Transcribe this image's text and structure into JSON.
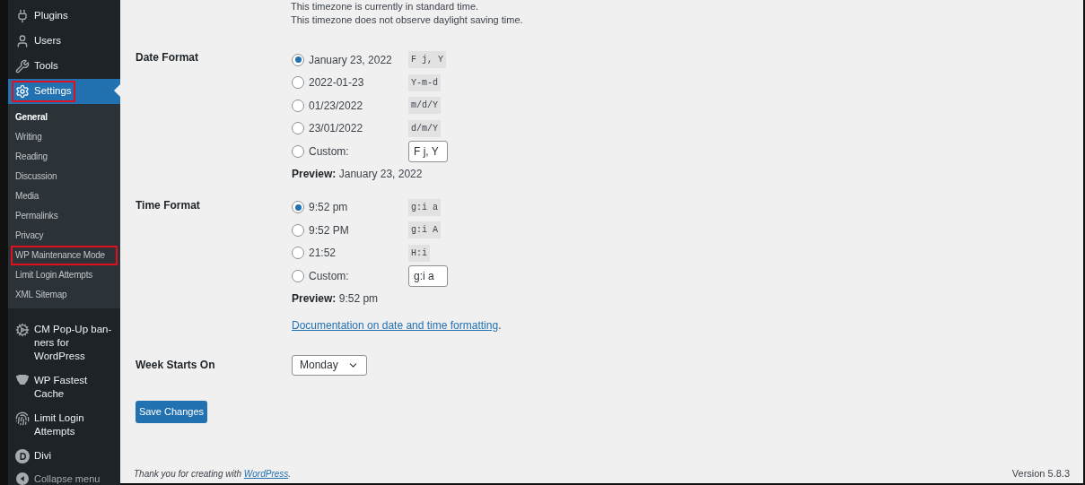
{
  "sidebar": {
    "items": [
      {
        "label": "Plugins",
        "selected": false,
        "highlighted": false
      },
      {
        "label": "Users",
        "selected": false,
        "highlighted": false
      },
      {
        "label": "Tools",
        "selected": false,
        "highlighted": false
      },
      {
        "label": "Settings",
        "selected": true,
        "highlighted": true,
        "submenu": [
          {
            "label": "General",
            "selected": true,
            "highlighted": false
          },
          {
            "label": "Writing",
            "selected": false,
            "highlighted": false
          },
          {
            "label": "Reading",
            "selected": false,
            "highlighted": false
          },
          {
            "label": "Discussion",
            "selected": false,
            "highlighted": false
          },
          {
            "label": "Media",
            "selected": false,
            "highlighted": false
          },
          {
            "label": "Permalinks",
            "selected": false,
            "highlighted": false
          },
          {
            "label": "Privacy",
            "selected": false,
            "highlighted": false
          },
          {
            "label": "WP Maintenance Mode",
            "selected": false,
            "highlighted": true
          },
          {
            "label": "Limit Login Attempts",
            "selected": false,
            "highlighted": false
          },
          {
            "label": "XML Sitemap",
            "selected": false,
            "highlighted": false
          }
        ]
      },
      {
        "label": "CM Pop-Up ban-ners for WordPress",
        "selected": false,
        "highlighted": false
      },
      {
        "label": "WP Fastest Cache",
        "selected": false,
        "highlighted": false
      },
      {
        "label": "Limit Login Attempts",
        "selected": false,
        "highlighted": false
      },
      {
        "label": "Divi",
        "selected": false,
        "highlighted": false
      }
    ],
    "collapse": "Collapse menu"
  },
  "timezone_notes": [
    "This timezone is currently in standard time.",
    "This timezone does not observe daylight saving time."
  ],
  "sections": [
    {
      "label": "Date Format",
      "options": [
        {
          "kind": "preset",
          "label": "January 23, 2022",
          "code": "F j, Y",
          "selected": true
        },
        {
          "kind": "preset",
          "label": "2022-01-23",
          "code": "Y-m-d",
          "selected": false
        },
        {
          "kind": "preset",
          "label": "01/23/2022",
          "code": "m/d/Y",
          "selected": false
        },
        {
          "kind": "preset",
          "label": "23/01/2022",
          "code": "d/m/Y",
          "selected": false
        },
        {
          "kind": "custom",
          "label": "Custom:",
          "value": "F j, Y",
          "selected": false
        }
      ],
      "preview_label": "Preview:",
      "preview": "January 23, 2022"
    },
    {
      "label": "Time Format",
      "options": [
        {
          "kind": "preset",
          "label": "9:52 pm",
          "code": "g:i a",
          "selected": true
        },
        {
          "kind": "preset",
          "label": "9:52 PM",
          "code": "g:i A",
          "selected": false
        },
        {
          "kind": "preset",
          "label": "21:52",
          "code": "H:i",
          "selected": false
        },
        {
          "kind": "custom",
          "label": "Custom:",
          "value": "g:i a",
          "selected": false
        }
      ],
      "preview_label": "Preview:",
      "preview": "9:52 pm",
      "doc_link": "Documentation on date and time formatting",
      "doc_suffix": "."
    }
  ],
  "week_starts": {
    "label": "Week Starts On",
    "value": "Monday"
  },
  "save_button": "Save Changes",
  "footer": {
    "thanks": "Thank you for creating with",
    "link": "WordPress",
    "suffix": ".",
    "version": "Version 5.8.3"
  }
}
